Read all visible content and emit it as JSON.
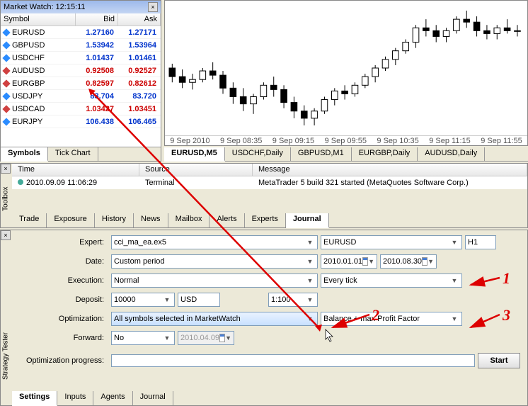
{
  "market_watch": {
    "title": "Market Watch: 12:15:11",
    "cols": {
      "symbol": "Symbol",
      "bid": "Bid",
      "ask": "Ask"
    },
    "rows": [
      {
        "sym": "EURUSD",
        "bid": "1.27160",
        "ask": "1.27171",
        "cls": "blue",
        "dir": "up"
      },
      {
        "sym": "GBPUSD",
        "bid": "1.53942",
        "ask": "1.53964",
        "cls": "blue",
        "dir": "up"
      },
      {
        "sym": "USDCHF",
        "bid": "1.01437",
        "ask": "1.01461",
        "cls": "blue",
        "dir": "up"
      },
      {
        "sym": "AUDUSD",
        "bid": "0.92508",
        "ask": "0.92527",
        "cls": "red",
        "dir": "dn"
      },
      {
        "sym": "EURGBP",
        "bid": "0.82597",
        "ask": "0.82612",
        "cls": "red",
        "dir": "dn"
      },
      {
        "sym": "USDJPY",
        "bid": "83.704",
        "ask": "83.720",
        "cls": "blue",
        "dir": "up"
      },
      {
        "sym": "USDCAD",
        "bid": "1.03427",
        "ask": "1.03451",
        "cls": "red",
        "dir": "dn"
      },
      {
        "sym": "EURJPY",
        "bid": "106.438",
        "ask": "106.465",
        "cls": "blue",
        "dir": "up"
      }
    ],
    "tabs": [
      "Symbols",
      "Tick Chart"
    ]
  },
  "chart": {
    "ticks": [
      "9 Sep 2010",
      "9 Sep 08:35",
      "9 Sep 09:15",
      "9 Sep 09:55",
      "9 Sep 10:35",
      "9 Sep 11:15",
      "9 Sep 11:55"
    ],
    "tabs": [
      "EURUSD,M5",
      "USDCHF,Daily",
      "GBPUSD,M1",
      "EURGBP,Daily",
      "AUDUSD,Daily"
    ]
  },
  "chart_data": {
    "type": "candlestick",
    "symbol": "EURUSD",
    "timeframe": "M5",
    "note": "approximate OHLC read from pixels",
    "candles": [
      {
        "o": 1.269,
        "h": 1.2693,
        "l": 1.268,
        "c": 1.2684
      },
      {
        "o": 1.2684,
        "h": 1.2689,
        "l": 1.2676,
        "c": 1.268
      },
      {
        "o": 1.268,
        "h": 1.2686,
        "l": 1.2675,
        "c": 1.2682
      },
      {
        "o": 1.2682,
        "h": 1.269,
        "l": 1.268,
        "c": 1.2688
      },
      {
        "o": 1.2688,
        "h": 1.2694,
        "l": 1.2682,
        "c": 1.2685
      },
      {
        "o": 1.2685,
        "h": 1.2688,
        "l": 1.2672,
        "c": 1.2676
      },
      {
        "o": 1.2676,
        "h": 1.268,
        "l": 1.2665,
        "c": 1.267
      },
      {
        "o": 1.267,
        "h": 1.2676,
        "l": 1.266,
        "c": 1.2665
      },
      {
        "o": 1.2665,
        "h": 1.2672,
        "l": 1.2658,
        "c": 1.267
      },
      {
        "o": 1.267,
        "h": 1.268,
        "l": 1.2668,
        "c": 1.2678
      },
      {
        "o": 1.2678,
        "h": 1.2684,
        "l": 1.267,
        "c": 1.2675
      },
      {
        "o": 1.2675,
        "h": 1.2678,
        "l": 1.2662,
        "c": 1.2666
      },
      {
        "o": 1.2666,
        "h": 1.267,
        "l": 1.2655,
        "c": 1.266
      },
      {
        "o": 1.266,
        "h": 1.2664,
        "l": 1.265,
        "c": 1.2655
      },
      {
        "o": 1.2655,
        "h": 1.2662,
        "l": 1.265,
        "c": 1.266
      },
      {
        "o": 1.266,
        "h": 1.267,
        "l": 1.2658,
        "c": 1.2668
      },
      {
        "o": 1.2668,
        "h": 1.2676,
        "l": 1.2664,
        "c": 1.2674
      },
      {
        "o": 1.2674,
        "h": 1.2678,
        "l": 1.2668,
        "c": 1.2672
      },
      {
        "o": 1.2672,
        "h": 1.268,
        "l": 1.267,
        "c": 1.2678
      },
      {
        "o": 1.2678,
        "h": 1.2686,
        "l": 1.2676,
        "c": 1.2684
      },
      {
        "o": 1.2684,
        "h": 1.2692,
        "l": 1.268,
        "c": 1.269
      },
      {
        "o": 1.269,
        "h": 1.2698,
        "l": 1.2688,
        "c": 1.2696
      },
      {
        "o": 1.2696,
        "h": 1.2704,
        "l": 1.2692,
        "c": 1.2702
      },
      {
        "o": 1.2702,
        "h": 1.271,
        "l": 1.27,
        "c": 1.2708
      },
      {
        "o": 1.2708,
        "h": 1.272,
        "l": 1.2704,
        "c": 1.2718
      },
      {
        "o": 1.2718,
        "h": 1.2724,
        "l": 1.2712,
        "c": 1.2716
      },
      {
        "o": 1.2716,
        "h": 1.272,
        "l": 1.2708,
        "c": 1.2712
      },
      {
        "o": 1.2712,
        "h": 1.2718,
        "l": 1.2708,
        "c": 1.2716
      },
      {
        "o": 1.2716,
        "h": 1.2726,
        "l": 1.2714,
        "c": 1.2724
      },
      {
        "o": 1.2724,
        "h": 1.273,
        "l": 1.2718,
        "c": 1.2722
      },
      {
        "o": 1.2722,
        "h": 1.2726,
        "l": 1.2712,
        "c": 1.2716
      },
      {
        "o": 1.2716,
        "h": 1.272,
        "l": 1.271,
        "c": 1.2714
      },
      {
        "o": 1.2714,
        "h": 1.272,
        "l": 1.271,
        "c": 1.2718
      },
      {
        "o": 1.2718,
        "h": 1.2724,
        "l": 1.2714,
        "c": 1.2716
      },
      {
        "o": 1.2716,
        "h": 1.272,
        "l": 1.2712,
        "c": 1.2716
      }
    ],
    "ylim": [
      1.265,
      1.273
    ]
  },
  "toolbox": {
    "label": "Toolbox",
    "cols": {
      "time": "Time",
      "source": "Source",
      "message": "Message"
    },
    "row": {
      "time": "2010.09.09 11:06:29",
      "source": "Terminal",
      "message": "MetaTrader 5 build 321 started (MetaQuotes Software Corp.)"
    },
    "tabs": [
      "Trade",
      "Exposure",
      "History",
      "News",
      "Mailbox",
      "Alerts",
      "Experts",
      "Journal"
    ]
  },
  "tester": {
    "label": "Strategy Tester",
    "rows": {
      "expert": {
        "label": "Expert:",
        "value": "cci_ma_ea.ex5",
        "symbol": "EURUSD",
        "period": "H1"
      },
      "date": {
        "label": "Date:",
        "value": "Custom period",
        "from": "2010.01.01",
        "to": "2010.08.30"
      },
      "execution": {
        "label": "Execution:",
        "value": "Normal",
        "mode": "Every tick"
      },
      "deposit": {
        "label": "Deposit:",
        "value": "10000",
        "currency": "USD",
        "leverage": "1:100"
      },
      "optimization": {
        "label": "Optimization:",
        "value": "All symbols selected in MarketWatch",
        "criterion": "Balance + max Profit Factor"
      },
      "forward": {
        "label": "Forward:",
        "value": "No",
        "date": "2010.04.09"
      },
      "progress": {
        "label": "Optimization progress:"
      }
    },
    "start": "Start",
    "tabs": [
      "Settings",
      "Inputs",
      "Agents",
      "Journal"
    ]
  },
  "annotations": {
    "n1": "1",
    "n2": "2",
    "n3": "3"
  }
}
